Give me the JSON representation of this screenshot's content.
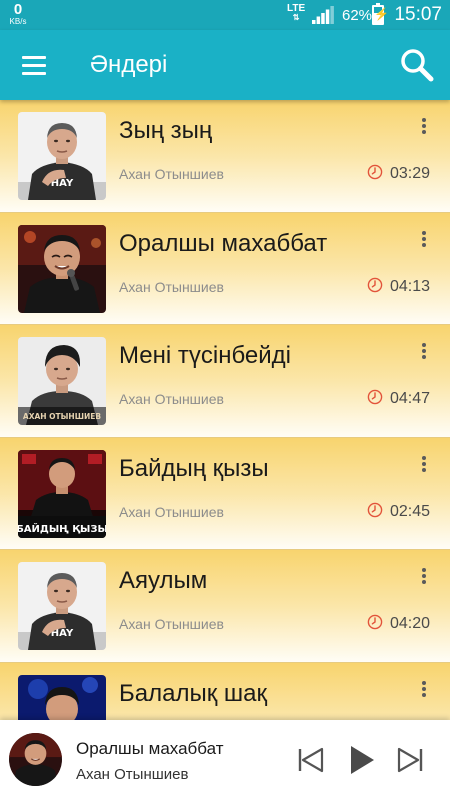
{
  "status_bar": {
    "net_speed": "0",
    "net_unit": "KB/s",
    "network": "LTE",
    "battery_percent": "62%",
    "battery_level": 0.62,
    "time": "15:07"
  },
  "app_bar": {
    "title": "Әндері",
    "menu_icon": "hamburger-menu-icon",
    "search_icon": "search-icon"
  },
  "songs": [
    {
      "title": "Зың зың",
      "artist": "Ахан Отыншиев",
      "duration": "03:29"
    },
    {
      "title": "Оралшы махаббат",
      "artist": "Ахан Отыншиев",
      "duration": "04:13"
    },
    {
      "title": "Мені түсінбейді",
      "artist": "Ахан Отыншиев",
      "duration": "04:47",
      "cover_text": "АХАН ОТЫНШИЕВ"
    },
    {
      "title": "Байдың қызы",
      "artist": "Ахан Отыншиев",
      "duration": "02:45",
      "cover_text": "БАЙДЫҢ ҚЫЗЫ"
    },
    {
      "title": "Аяулым",
      "artist": "Ахан Отыншиев",
      "duration": "04:20"
    },
    {
      "title": "Балалық шақ",
      "artist": "",
      "duration": ""
    }
  ],
  "player": {
    "title": "Оралшы махаббат",
    "artist": "Ахан Отыншиев",
    "prev_icon": "skip-previous-icon",
    "play_icon": "play-icon",
    "next_icon": "skip-next-icon"
  },
  "colors": {
    "status_bar": "#1aa7b8",
    "app_bar": "#1ab1c6",
    "row_top": "#f8d46e",
    "row_bottom": "#fffdf6",
    "clock_icon": "#e2533a"
  }
}
